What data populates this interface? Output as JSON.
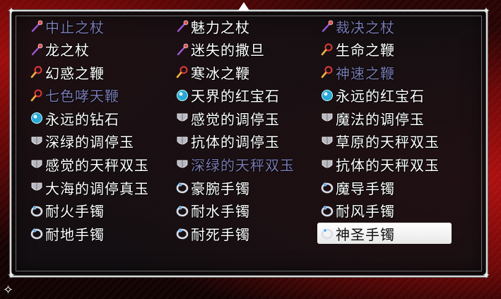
{
  "colors": {
    "enabled_text": "#ffffff",
    "disabled_text": "#7a79b0",
    "selected_background": "#ffffff",
    "window_border": "#d8d8d8",
    "scene_red": "#a00c0c"
  },
  "inventory": {
    "selected_index": 29,
    "items": [
      {
        "label": "中止之杖",
        "icon": "staff-icon",
        "enabled": false
      },
      {
        "label": "魅力之杖",
        "icon": "staff-icon",
        "enabled": true
      },
      {
        "label": "裁决之杖",
        "icon": "staff-icon",
        "enabled": false
      },
      {
        "label": "龙之杖",
        "icon": "staff-icon",
        "enabled": true
      },
      {
        "label": "迷失的撒旦",
        "icon": "staff-icon",
        "enabled": true
      },
      {
        "label": "生命之鞭",
        "icon": "whip-icon",
        "enabled": true
      },
      {
        "label": "幻惑之鞭",
        "icon": "whip-icon",
        "enabled": true
      },
      {
        "label": "寒冰之鞭",
        "icon": "whip-icon",
        "enabled": true
      },
      {
        "label": "神速之鞭",
        "icon": "whip-icon",
        "enabled": false
      },
      {
        "label": "七色哮天鞭",
        "icon": "whip-icon",
        "enabled": false
      },
      {
        "label": "天界的红宝石",
        "icon": "gem-icon",
        "enabled": true
      },
      {
        "label": "永远的红宝石",
        "icon": "gem-icon",
        "enabled": true
      },
      {
        "label": "永远的钻石",
        "icon": "gem-icon",
        "enabled": true
      },
      {
        "label": "感觉的调停玉",
        "icon": "jade-icon",
        "enabled": true
      },
      {
        "label": "魔法的调停玉",
        "icon": "jade-icon",
        "enabled": true
      },
      {
        "label": "深绿的调停玉",
        "icon": "jade-icon",
        "enabled": true
      },
      {
        "label": "抗体的调停玉",
        "icon": "jade-icon",
        "enabled": true
      },
      {
        "label": "草原的天秤双玉",
        "icon": "jade-icon",
        "enabled": true
      },
      {
        "label": "感觉的天秤双玉",
        "icon": "jade-icon",
        "enabled": true
      },
      {
        "label": "深绿的天秤双玉",
        "icon": "jade-icon",
        "enabled": false
      },
      {
        "label": "抗体的天秤双玉",
        "icon": "jade-icon",
        "enabled": true
      },
      {
        "label": "大海的调停真玉",
        "icon": "jade-icon",
        "enabled": true
      },
      {
        "label": "豪腕手镯",
        "icon": "bracelet-icon",
        "enabled": true
      },
      {
        "label": "魔导手镯",
        "icon": "bracelet-icon",
        "enabled": true
      },
      {
        "label": "耐火手镯",
        "icon": "bracelet-icon",
        "enabled": true
      },
      {
        "label": "耐水手镯",
        "icon": "bracelet-icon",
        "enabled": true
      },
      {
        "label": "耐风手镯",
        "icon": "bracelet-icon",
        "enabled": true
      },
      {
        "label": "耐地手镯",
        "icon": "bracelet-icon",
        "enabled": true
      },
      {
        "label": "耐死手镯",
        "icon": "bracelet-icon",
        "enabled": true
      },
      {
        "label": "神圣手镯",
        "icon": "bracelet-icon",
        "enabled": true
      }
    ]
  }
}
